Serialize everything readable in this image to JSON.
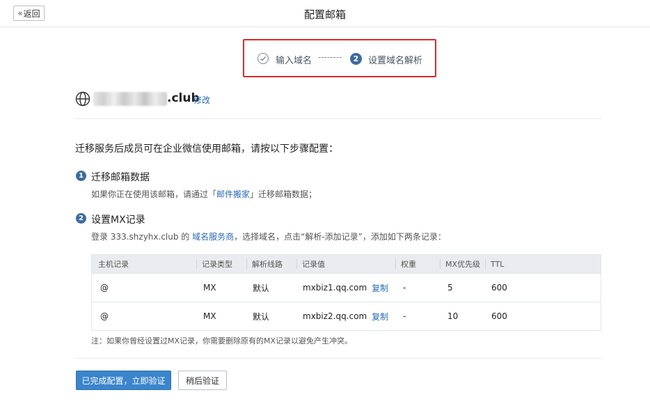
{
  "header": {
    "back_label": "返回",
    "back_chevron": "«",
    "title": "配置邮箱"
  },
  "steps": {
    "step1_label": "输入域名",
    "connector": "--------",
    "step2_number": "2",
    "step2_label": "设置域名解析"
  },
  "domain": {
    "suffix": ".club",
    "edit_label": "修改"
  },
  "intro": "迁移服务后成员可在企业微信使用邮箱，请按以下步骤配置：",
  "step_migrate": {
    "number": "1",
    "title": "迁移邮箱数据",
    "desc_prefix": "如果你正在使用该邮箱，请通过「",
    "desc_link": "邮件搬家",
    "desc_suffix": "」迁移邮箱数据；"
  },
  "step_mx": {
    "number": "2",
    "title": "设置MX记录",
    "desc_prefix": "登录 333.shzyhx.club 的 ",
    "desc_link": "域名服务商",
    "desc_suffix": "，选择域名，点击“解析-添加记录”，添加如下两条记录："
  },
  "table": {
    "headers": [
      "主机记录",
      "记录类型",
      "解析线路",
      "记录值",
      "权重",
      "MX优先级",
      "TTL"
    ],
    "copy_label": "复制",
    "rows": [
      {
        "host": "@",
        "type": "MX",
        "line": "默认",
        "value": "mxbiz1.qq.com",
        "weight": "-",
        "priority": "5",
        "ttl": "600"
      },
      {
        "host": "@",
        "type": "MX",
        "line": "默认",
        "value": "mxbiz2.qq.com",
        "weight": "-",
        "priority": "10",
        "ttl": "600"
      }
    ]
  },
  "note": "注：如果你曾经设置过MX记录，你需要删除原有的MX记录以避免产生冲突。",
  "actions": {
    "verify_now_label": "已完成配置，立即验证",
    "verify_later_label": "稍后验证"
  },
  "colors": {
    "accent": "#3a85cb",
    "link": "#2a6bb0",
    "highlight_border": "#e02828",
    "badge": "#3e6b9c"
  },
  "icons": {
    "back": "double-chevron-left-icon",
    "step_done": "check-circle-icon",
    "domain": "globe-icon"
  }
}
